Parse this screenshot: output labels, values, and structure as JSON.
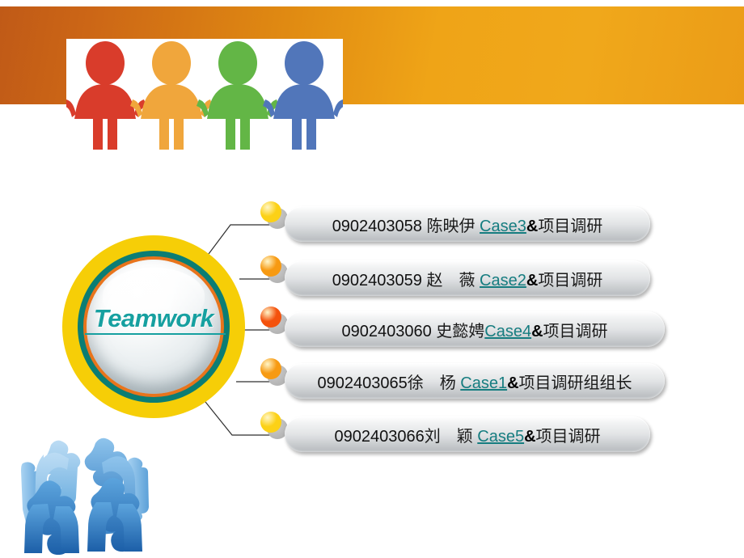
{
  "slide": {
    "background_color": "#ffffff",
    "band": {
      "color_left": "#c05a17",
      "color_right": "#f0a81b",
      "photo_alt": "four-colored-people-icons"
    },
    "emblem": {
      "label": "Teamwork",
      "label_color": "#16a0a0",
      "ring_outer_color": "#f6ce07",
      "ring_teal_color": "#0b7d74",
      "ring_orange_color": "#e8741c"
    },
    "rows": [
      {
        "dot_color": "#fcd116",
        "id": "0902403058",
        "name": "陈映伊",
        "case": "Case3",
        "amp": "&",
        "task": "项目调研"
      },
      {
        "dot_color": "#f79a12",
        "id": "0902403059",
        "name": "赵　薇",
        "case": "Case2",
        "amp": "&",
        "task": "项目调研"
      },
      {
        "dot_color": "#f4520d",
        "id": "0902403060",
        "name": "史懿娉",
        "case": "Case4",
        "amp": "&",
        "task": "项目调研"
      },
      {
        "dot_color": "#f79a12",
        "id": "0902403065",
        "name": "徐　杨",
        "case": "Case1",
        "amp": "&",
        "task": "项目调研组组长"
      },
      {
        "dot_color": "#fcd116",
        "id": "0902403066",
        "name": "刘　颖",
        "case": "Case5",
        "amp": "&",
        "task": "项目调研"
      }
    ],
    "puzzle_graphic": "blue-puzzle-people-circle"
  }
}
